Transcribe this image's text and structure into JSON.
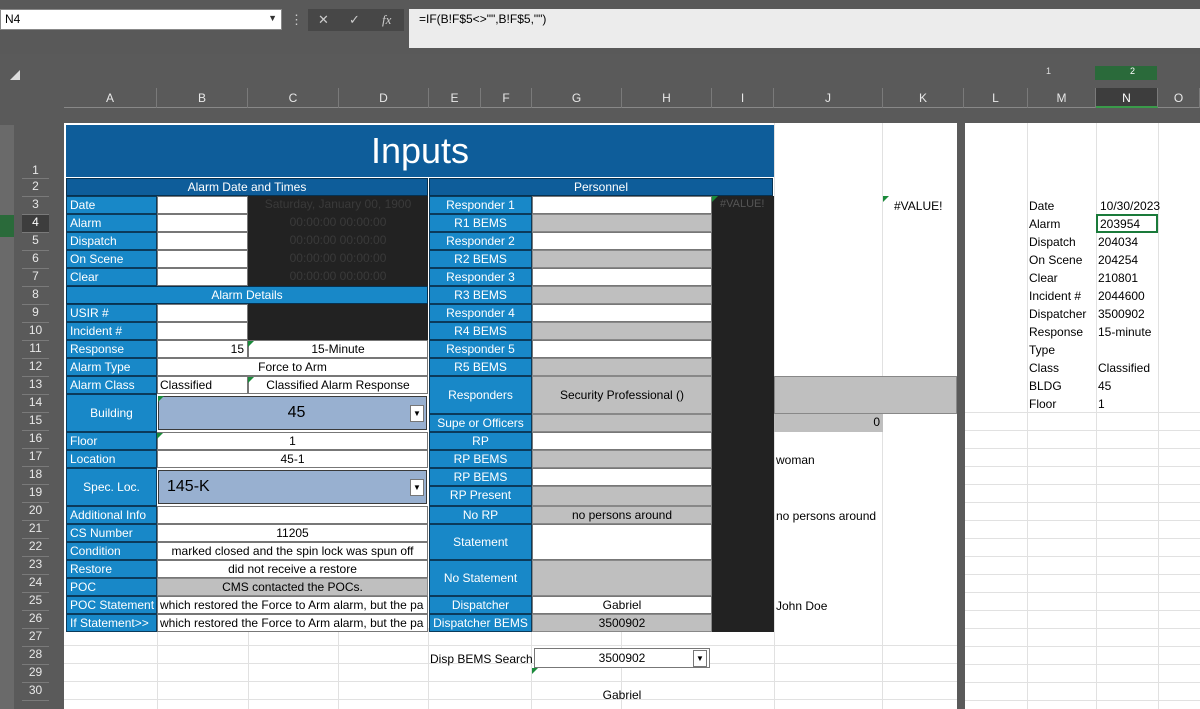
{
  "formula_bar": {
    "name_box": "N4",
    "formula": "=IF(B!F$5<>\"\",B!F$5,\"\")",
    "cancel_icon": "close-icon",
    "enter_icon": "check-icon",
    "fx_label": "fx"
  },
  "columns": [
    "A",
    "B",
    "C",
    "D",
    "E",
    "F",
    "G",
    "H",
    "I",
    "J",
    "K",
    "L",
    "M",
    "N",
    "O"
  ],
  "rows": [
    "1",
    "2",
    "3",
    "4",
    "5",
    "6",
    "7",
    "8",
    "9",
    "10",
    "11",
    "12",
    "13",
    "14",
    "15",
    "16",
    "17",
    "18",
    "19",
    "20",
    "21",
    "22",
    "23",
    "24",
    "25",
    "26",
    "27",
    "28",
    "29",
    "30"
  ],
  "ruler_marks": {
    "r1": "1",
    "r2": "2"
  },
  "sheet": {
    "title": "Inputs",
    "alarm_header": "Alarm Date and Times",
    "personnel_header": "Personnel",
    "alarm_details_header": "Alarm Details",
    "labels": {
      "date": "Date",
      "alarm": "Alarm",
      "dispatch": "Dispatch",
      "on_scene": "On Scene",
      "clear": "Clear",
      "usir": "USIR #",
      "incident": "Incident #",
      "response": "Response",
      "alarm_type": "Alarm Type",
      "alarm_class": "Alarm Class",
      "building": "Building",
      "floor": "Floor",
      "location": "Location",
      "spec_loc": "Spec. Loc.",
      "additional_info": "Additional Info",
      "cs_number": "CS Number",
      "condition": "Condition",
      "restore": "Restore",
      "poc": "POC",
      "poc_statement": "POC Statement",
      "if_statement": "If Statement>>"
    },
    "values": {
      "date_text": "Saturday, January 00, 1900",
      "alarm_time": "00:00:00 00:00:00",
      "dispatch_time": "00:00:00 00:00:00",
      "onscene_time": "00:00:00 00:00:00",
      "clear_time": "00:00:00 00:00:00",
      "response_num": "15",
      "response_text": "15-Minute",
      "alarm_type": "Force to Arm",
      "alarm_class": "Classified",
      "alarm_class_text": "Classified Alarm Response",
      "building": "45",
      "floor": "1",
      "location": "45-1",
      "spec_loc": "145-K",
      "cs_number": "11205",
      "condition": "marked closed and the spin lock was spun off",
      "restore": "did not receive a restore",
      "poc": "CMS contacted the POCs.",
      "poc_statement": "which restored the Force to Arm alarm, but the pa",
      "if_statement": "which restored the Force to Arm alarm, but the pa"
    },
    "personnel": {
      "responder1": "Responder 1",
      "r1bems": "R1 BEMS",
      "responder2": "Responder 2",
      "r2bems": "R2 BEMS",
      "responder3": "Responder 3",
      "r3bems": "R3 BEMS",
      "responder4": "Responder 4",
      "r4bems": "R4 BEMS",
      "responder5": "Responder 5",
      "r5bems": "R5 BEMS",
      "responders": "Responders",
      "responders_value": "Security Professional  ()",
      "supe": "Supe or Officers",
      "supe_value": "0",
      "rp": "RP",
      "rp_bems": "RP BEMS",
      "rp_bems2": "RP BEMS",
      "rp_present": "RP Present",
      "no_rp": "No RP",
      "no_rp_value": "no persons around",
      "statement": "Statement",
      "no_statement": "No Statement",
      "dispatcher": "Dispatcher",
      "dispatcher_value": "Gabriel",
      "dispatcher_bems": "Dispatcher BEMS",
      "dispatcher_bems_value": "3500902",
      "value_error": "#VALUE!"
    },
    "side_j": {
      "value_error": "#VALUE!",
      "woman": "woman",
      "no_persons": "no persons around",
      "john": "John Doe"
    },
    "search": {
      "label": "Disp BEMS Search",
      "value": "3500902",
      "result": "Gabriel"
    }
  },
  "summary": [
    {
      "label": "Date",
      "value": "10/30/2023"
    },
    {
      "label": "Alarm",
      "value": "203954"
    },
    {
      "label": "Dispatch",
      "value": "204034"
    },
    {
      "label": "On Scene",
      "value": "204254"
    },
    {
      "label": "Clear",
      "value": "210801"
    },
    {
      "label": "Incident #",
      "value": "2044600"
    },
    {
      "label": "Dispatcher",
      "value": "3500902"
    },
    {
      "label": "Response",
      "value": "15-minute"
    },
    {
      "label": "Type",
      "value": ""
    },
    {
      "label": "Class",
      "value": "Classified"
    },
    {
      "label": "BLDG",
      "value": "45"
    },
    {
      "label": "Floor",
      "value": "1"
    }
  ]
}
